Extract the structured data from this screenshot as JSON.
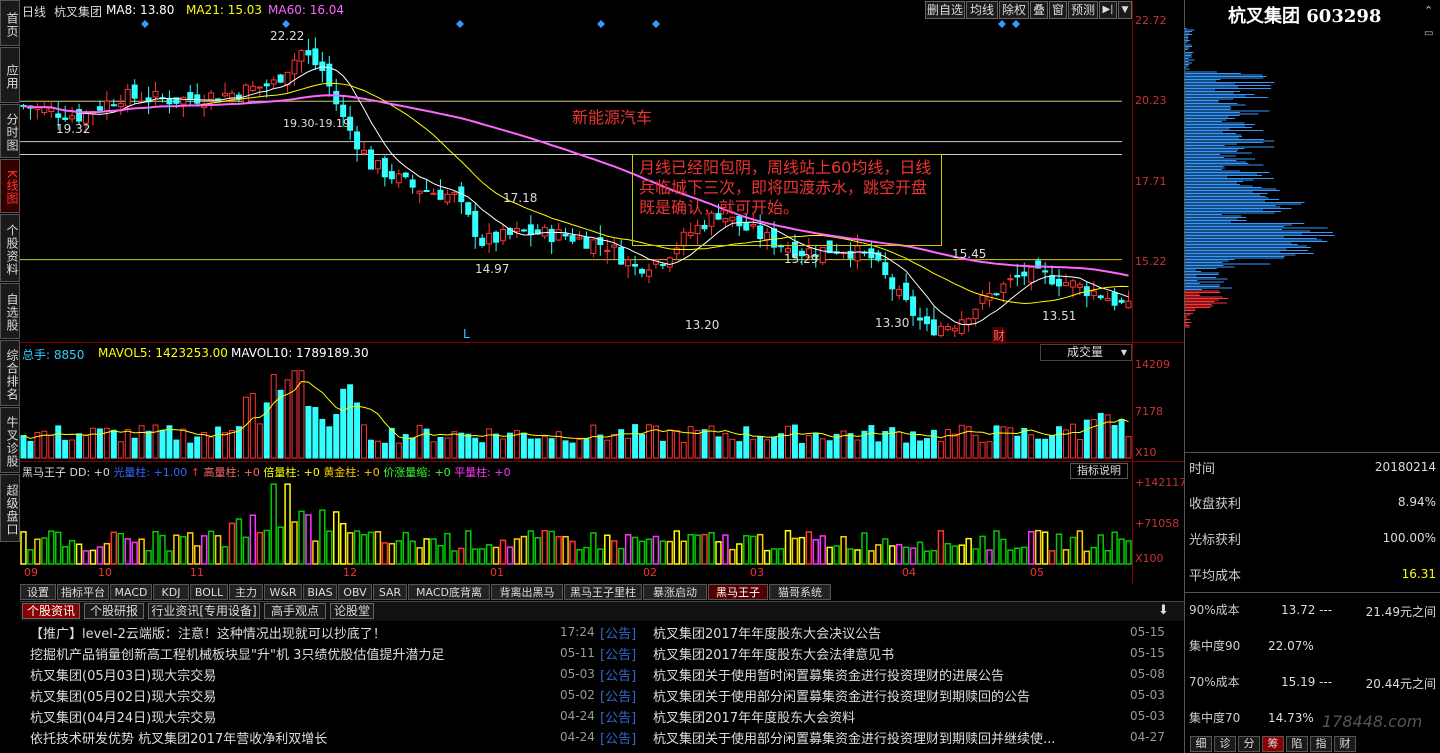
{
  "header": {
    "chart_label": "日线",
    "stock_name": "杭叉集团",
    "ma8": "MA8: 13.80",
    "ma21": "MA21: 15.03",
    "ma60": "MA60: 16.04",
    "buttons": [
      "删自选",
      "均线",
      "除权",
      "叠",
      "窗",
      "预测"
    ]
  },
  "sidebar": {
    "items": [
      "首页",
      "应用",
      "分时图",
      "K线图",
      "个股资料",
      "自选股",
      "综合排名",
      "牛叉诊股",
      "超级盘口"
    ]
  },
  "price_axis": [
    "22.72",
    "20.23",
    "17.71",
    "15.22"
  ],
  "annotations": {
    "sector": "新能源汽车",
    "comment": "月线已经阳包阴，周线站上60均线，日线兵临城下三次，即将四渡赤水，跳空开盘既是确认，就可开始。",
    "hi1": "22.22",
    "lo1": "19.32",
    "gap": "19.30-19.19",
    "p1718": "17.18",
    "p1497": "14.97",
    "p1529": "15.29",
    "p1545": "15.45",
    "p1320": "13.20",
    "p1330": "13.30",
    "p1351": "13.51",
    "marker_L": "L",
    "marker_cai": "财"
  },
  "volume": {
    "total": "总手: 8850",
    "mavol5": "MAVOL5: 1423253.00",
    "mavol10": "MAVOL10: 1789189.30",
    "dropdown": "成交量",
    "axis": [
      "14209",
      "7178",
      "X10"
    ]
  },
  "indicator": {
    "name": "黑马王子",
    "dd": "DD: +0",
    "guang": "光量柱: +1.00",
    "gao": "高量柱: +0",
    "bei": "倍量柱: +0",
    "huang": "黄金柱: +0",
    "jia": "价涨量缩: +0",
    "ping": "平量柱: +0",
    "help_btn": "指标说明",
    "axis": [
      "+142117",
      "+71058",
      "X100"
    ]
  },
  "months": [
    "09",
    "10",
    "11",
    "12",
    "01",
    "02",
    "03",
    "04",
    "05"
  ],
  "indicator_tabs": [
    "设置",
    "指标平台",
    "MACD",
    "KDJ",
    "BOLL",
    "主力",
    "W&R",
    "BIAS",
    "OBV",
    "SAR",
    "MACD底背离",
    "背离出黑马",
    "黑马王子里柱",
    "暴涨启动",
    "黑马王子",
    "猫哥系统"
  ],
  "news_tabs": [
    "个股资讯",
    "个股研报",
    "行业资讯[专用设备]",
    "高手观点",
    "论股堂"
  ],
  "news_left": [
    {
      "title": "【推广】level-2云端版：注意！这种情况出现就可以抄底了！",
      "date": "17:24"
    },
    {
      "title": "挖掘机产品销量创新高工程机械板块显\"升\"机 3只绩优股估值提升潜力足",
      "date": "05-11"
    },
    {
      "title": "杭叉集团(05月03日)现大宗交易",
      "date": "05-03"
    },
    {
      "title": "杭叉集团(05月02日)现大宗交易",
      "date": "05-02"
    },
    {
      "title": "杭叉集团(04月24日)现大宗交易",
      "date": "04-24"
    },
    {
      "title": "依托技术研发优势 杭叉集团2017年营收净利双增长",
      "date": "04-24"
    }
  ],
  "news_right": [
    {
      "tag": "[公告]",
      "title": "杭叉集团2017年年度股东大会决议公告",
      "date": "05-15"
    },
    {
      "tag": "[公告]",
      "title": "杭叉集团2017年年度股东大会法律意见书",
      "date": "05-15"
    },
    {
      "tag": "[公告]",
      "title": "杭叉集团关于使用暂时闲置募集资金进行投资理财的进展公告",
      "date": "05-08"
    },
    {
      "tag": "[公告]",
      "title": "杭叉集团关于使用部分闲置募集资金进行投资理财到期赎回的公告",
      "date": "05-03"
    },
    {
      "tag": "[公告]",
      "title": "杭叉集团2017年年度股东大会资料",
      "date": "05-03"
    },
    {
      "tag": "[公告]",
      "title": "杭叉集团关于使用部分闲置募集资金进行投资理财到期赎回并继续使...",
      "date": "04-27"
    }
  ],
  "right_panel": {
    "title": "杭叉集团 603298",
    "rows": [
      {
        "label": "时间",
        "value": "20180214"
      },
      {
        "label": "收盘获利",
        "value": "8.94%"
      },
      {
        "label": "光标获利",
        "value": "100.00%"
      },
      {
        "label": "平均成本",
        "value": "16.31"
      }
    ],
    "cost90_label": "90%成本",
    "cost90_range": "13.72 ---",
    "cost90_hi": "21.49元之间",
    "conc90_label": "集中度90",
    "conc90": "22.07%",
    "cost70_label": "70%成本",
    "cost70_range": "15.19 ---",
    "cost70_hi": "20.44元之间",
    "conc70_label": "集中度70",
    "conc70": "14.73%",
    "bottom_tabs": [
      "细",
      "诊",
      "分",
      "筹",
      "陷",
      "指",
      "财"
    ],
    "watermark": "178448.com"
  },
  "colors": {
    "up": "#ff3333",
    "down": "#33ffff",
    "ma8": "#ffffff",
    "ma21": "#ffff00",
    "ma60": "#ff66ff",
    "accent": "#cc3333"
  }
}
